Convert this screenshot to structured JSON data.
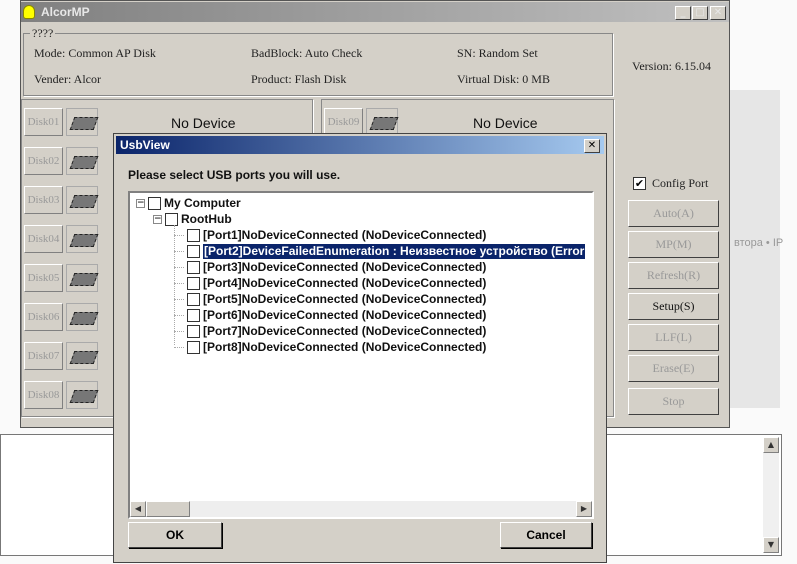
{
  "background": {
    "partial_text": "втора • IP"
  },
  "app": {
    "title": "AlcorMP",
    "group_title": "????",
    "mode": "Mode:  Common AP Disk",
    "badblock": "BadBlock:  Auto Check",
    "sn": "SN:  Random Set",
    "vender": "Vender:  Alcor",
    "product": "Product:  Flash Disk",
    "virtual_disk": "Virtual Disk:  0 MB",
    "version": "Version: 6.15.04",
    "disks_left": [
      "Disk01",
      "Disk02",
      "Disk03",
      "Disk04",
      "Disk05",
      "Disk06",
      "Disk07",
      "Disk08"
    ],
    "disk_right": "Disk09",
    "no_device": "No Device",
    "config_port": {
      "label": "Config Port",
      "checked": true,
      "mark": "✔"
    },
    "buttons": [
      {
        "label": "Auto(A)",
        "enabled": false
      },
      {
        "label": "MP(M)",
        "enabled": false
      },
      {
        "label": "Refresh(R)",
        "enabled": false
      },
      {
        "label": "Setup(S)",
        "enabled": true
      },
      {
        "label": "LLF(L)",
        "enabled": false
      },
      {
        "label": "Erase(E)",
        "enabled": false
      },
      {
        "label": "Stop",
        "enabled": false
      }
    ]
  },
  "dialog": {
    "title": "UsbView",
    "prompt": "Please select USB ports you will use.",
    "root": "My Computer",
    "hub": "RootHub",
    "ports": [
      "[Port1]NoDeviceConnected (NoDeviceConnected)",
      "[Port2]DeviceFailedEnumeration :  Неизвестное устройство (Error",
      "[Port3]NoDeviceConnected (NoDeviceConnected)",
      "[Port4]NoDeviceConnected (NoDeviceConnected)",
      "[Port5]NoDeviceConnected (NoDeviceConnected)",
      "[Port6]NoDeviceConnected (NoDeviceConnected)",
      "[Port7]NoDeviceConnected (NoDeviceConnected)",
      "[Port8]NoDeviceConnected (NoDeviceConnected)"
    ],
    "selected_port": 1,
    "ok": "OK",
    "cancel": "Cancel"
  }
}
